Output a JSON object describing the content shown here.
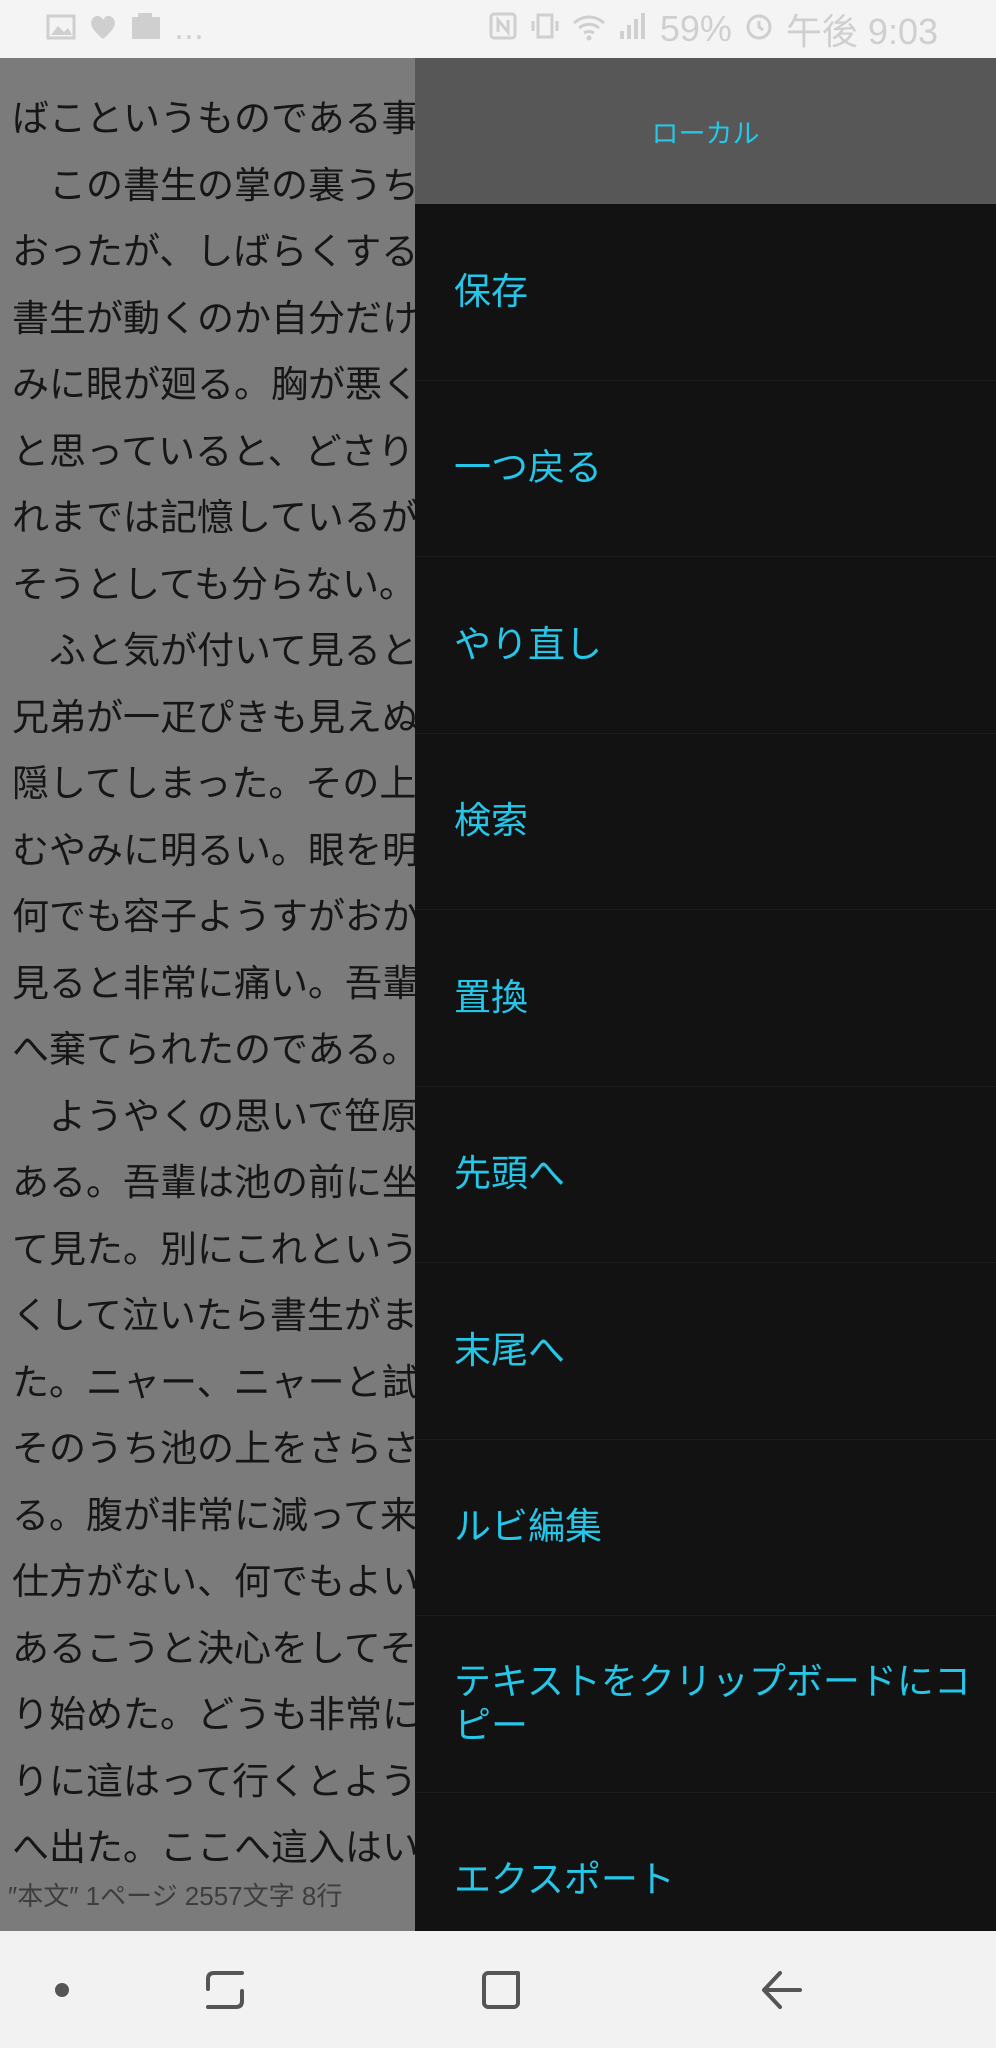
{
  "status_bar": {
    "battery": "59%",
    "time": "午後 9:03",
    "left_icons": [
      "image-icon",
      "heart-icon",
      "photo-icon",
      "more-dots-icon"
    ],
    "right_icons": [
      "nfc-icon",
      "vibrate-icon",
      "wifi-icon",
      "signal-icon",
      "alarm-icon"
    ]
  },
  "editor": {
    "lines": [
      "ばこというものである事",
      "　この書生の掌の裏うち",
      "おったが、しばらくする",
      "書生が動くのか自分だけ",
      "みに眼が廻る。胸が悪く",
      "と思っていると、どさり",
      "れまでは記憶しているが",
      "そうとしても分らない。",
      "　ふと気が付いて見ると",
      "兄弟が一疋ぴきも見えぬ",
      "隠してしまった。その上",
      "むやみに明るい。眼を明",
      "何でも容子ようすがおか",
      "見ると非常に痛い。吾輩",
      "へ棄てられたのである。",
      "　ようやくの思いで笹原",
      "ある。吾輩は池の前に坐",
      "て見た。別にこれという",
      "くして泣いたら書生がま",
      "た。ニャー、ニャーと試",
      "そのうち池の上をさらさ",
      "る。腹が非常に減って来",
      "仕方がない、何でもよい",
      "あるこうと決心をしてそ",
      "り始めた。どうも非常に",
      "りに這はって行くとよう",
      "へ出た。ここへ這入はい"
    ],
    "status_text": "″本文″ 1ページ 2557文字 8行"
  },
  "drawer": {
    "title": "ローカル",
    "items": [
      {
        "label": "保存"
      },
      {
        "label": "一つ戻る"
      },
      {
        "label": "やり直し"
      },
      {
        "label": "検索"
      },
      {
        "label": "置換"
      },
      {
        "label": "先頭へ"
      },
      {
        "label": "末尾へ"
      },
      {
        "label": "ルビ編集"
      },
      {
        "label": "テキストをクリップボードにコピー"
      },
      {
        "label": "エクスポート"
      }
    ]
  },
  "nav_bar": {
    "buttons": [
      "dot-icon",
      "recent-apps-icon",
      "home-icon",
      "back-icon"
    ]
  },
  "colors": {
    "accent": "#26c6e8",
    "drawer_bg": "#121212",
    "drawer_header_bg": "#575757",
    "editor_overlay": "#7b7b7b"
  }
}
